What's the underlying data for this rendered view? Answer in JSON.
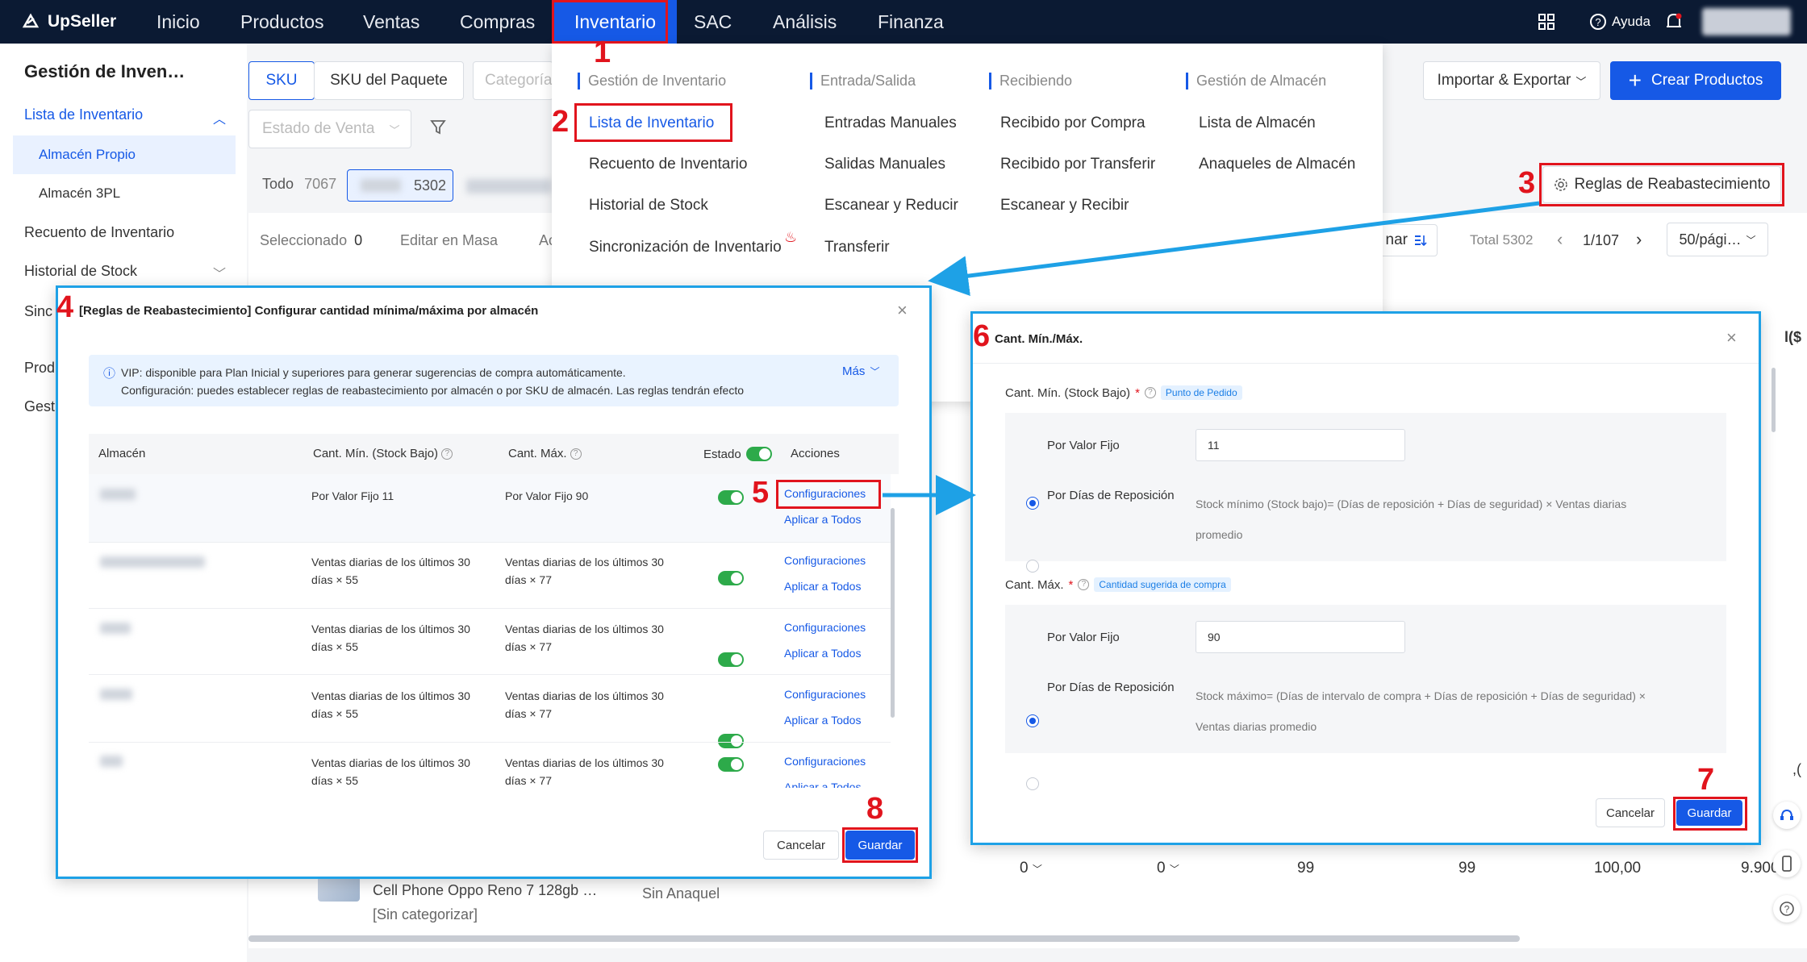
{
  "brand": {
    "name": "UpSeller"
  },
  "nav": {
    "items": [
      "Inicio",
      "Productos",
      "Ventas",
      "Compras",
      "Inventario",
      "SAC",
      "Análisis",
      "Finanza"
    ],
    "help": "Ayuda"
  },
  "sidebar": {
    "title": "Gestión de Inven…",
    "lista": "Lista de Inventario",
    "almacen_propio": "Almacén Propio",
    "almacen_3pl": "Almacén 3PL",
    "recuento": "Recuento de Inventario",
    "historial": "Historial de Stock",
    "sinc": "Sinc",
    "prod": "Prod",
    "gest": "Gest"
  },
  "main": {
    "tab_sku": "SKU",
    "tab_paquete": "SKU del Paquete",
    "categoria_placeholder": "Categoría",
    "estado_venta_placeholder": "Estado de Venta",
    "importar": "Importar & Exportar",
    "crear": "Crear Productos",
    "todo_label": "Todo",
    "todo_count": "7067",
    "count_2": "5302",
    "reglas": "Reglas de Reabastecimiento",
    "seleccionado": "Seleccionado",
    "seleccionado_count": "0",
    "editar_masa": "Editar en Masa",
    "acc_partial": "Ac",
    "ordenar_partial": "nar",
    "total": "Total 5302",
    "page": "1/107",
    "per_page": "50/pági…",
    "edge_1": "l($",
    "edge_2": ",(",
    "product_name": "Cell Phone Oppo Reno 7 128gb …",
    "product_cat": "[Sin categorizar]",
    "sin_anaquel": "Sin Anaquel",
    "row_values": [
      "0",
      "0",
      "99",
      "99",
      "100,00",
      "9.900,("
    ]
  },
  "mega": {
    "col1_head": "Gestión de Inventario",
    "col1": [
      "Lista de Inventario",
      "Recuento de Inventario",
      "Historial de Stock",
      "Sincronización de Inventario"
    ],
    "col2_head": "Entrada/Salida",
    "col2": [
      "Entradas Manuales",
      "Salidas Manuales",
      "Escanear y Reducir",
      "Transferir"
    ],
    "col3_head": "Recibiendo",
    "col3": [
      "Recibido por Compra",
      "Recibido por Transferir",
      "Escanear y Recibir"
    ],
    "col4_head": "Gestión de Almacén",
    "col4": [
      "Lista de Almacén",
      "Anaqueles de Almacén"
    ]
  },
  "modal1": {
    "title": "[Reglas de Reabastecimiento] Configurar cantidad mínima/máxima por almacén",
    "info_line1": "VIP: disponible para Plan Inicial y superiores para generar sugerencias de compra automáticamente.",
    "info_line2": "Configuración: puedes establecer reglas de reabastecimiento por almacén o por SKU de almacén. Las reglas tendrán efecto",
    "mas": "Más",
    "headers": {
      "almacen": "Almacén",
      "min": "Cant. Mín. (Stock Bajo)",
      "max": "Cant. Máx.",
      "estado": "Estado",
      "acciones": "Acciones"
    },
    "row1": {
      "min": "Por Valor Fijo 11",
      "max": "Por Valor Fijo 90"
    },
    "row_min_l1": "Ventas diarias de los últimos 30",
    "row_min_l2": "días × 55",
    "row_max_l1": "Ventas diarias de los últimos 30",
    "row_max_l2": "días × 77",
    "config": "Configuraciones",
    "aplicar": "Aplicar a Todos",
    "cancelar": "Cancelar",
    "guardar": "Guardar"
  },
  "modal2": {
    "title": "Cant. Mín./Máx.",
    "min_label": "Cant. Mín. (Stock Bajo)",
    "min_tag": "Punto de Pedido",
    "opt_fijo": "Por Valor Fijo",
    "opt_dias": "Por Días de Reposición",
    "min_value": "11",
    "min_formula_l1": "Stock mínimo (Stock bajo)= (Días de reposición + Días de seguridad) × Ventas diarias",
    "min_formula_l2": "promedio",
    "max_label": "Cant. Máx.",
    "max_tag": "Cantidad sugerida de compra",
    "max_value": "90",
    "max_formula_l1": "Stock máximo= (Días de intervalo de compra + Días de reposición + Días de seguridad) ×",
    "max_formula_l2": "Ventas diarias promedio",
    "cancelar": "Cancelar",
    "guardar": "Guardar"
  },
  "annotations": {
    "n1": "1",
    "n2": "2",
    "n3": "3",
    "n4": "4",
    "n5": "5",
    "n6": "6",
    "n7": "7",
    "n8": "8"
  }
}
